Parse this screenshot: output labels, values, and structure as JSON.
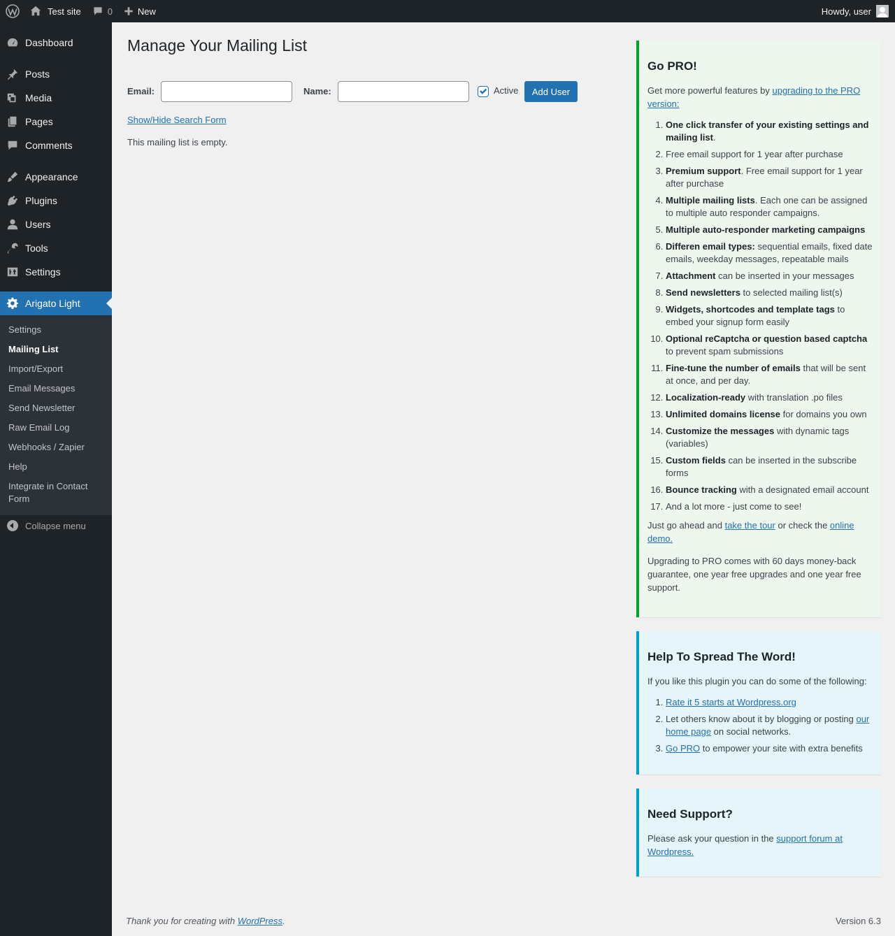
{
  "adminbar": {
    "site_name": "Test site",
    "comments_count": "0",
    "new_label": "New",
    "howdy": "Howdy, user"
  },
  "menu": {
    "items": [
      {
        "label": "Dashboard",
        "icon": "dashboard-icon"
      },
      {
        "label": "Posts",
        "icon": "pin-icon"
      },
      {
        "label": "Media",
        "icon": "media-icon"
      },
      {
        "label": "Pages",
        "icon": "pages-icon"
      },
      {
        "label": "Comments",
        "icon": "comment-icon"
      },
      {
        "label": "Appearance",
        "icon": "brush-icon"
      },
      {
        "label": "Plugins",
        "icon": "plug-icon"
      },
      {
        "label": "Users",
        "icon": "user-icon"
      },
      {
        "label": "Tools",
        "icon": "wrench-icon"
      },
      {
        "label": "Settings",
        "icon": "settings-icon"
      },
      {
        "label": "Arigato Light",
        "icon": "gear-icon"
      }
    ],
    "submenu": [
      "Settings",
      "Mailing List",
      "Import/Export",
      "Email Messages",
      "Send Newsletter",
      "Raw Email Log",
      "Webhooks / Zapier",
      "Help",
      "Integrate in Contact Form"
    ],
    "collapse_label": "Collapse menu"
  },
  "main": {
    "title": "Manage Your Mailing List",
    "email_label": "Email:",
    "name_label": "Name:",
    "active_label": "Active",
    "add_button": "Add User",
    "toggle_search": "Show/Hide Search Form",
    "empty_message": "This mailing list is empty."
  },
  "pro_box": {
    "title": "Go PRO!",
    "intro_text": "Get more powerful features by ",
    "intro_link": "upgrading to the PRO version:",
    "features": [
      {
        "bold": "One click transfer of your existing settings and mailing list",
        "rest": "."
      },
      {
        "bold": "",
        "rest": "Free email support for 1 year after purchase"
      },
      {
        "bold": "Premium support",
        "rest": ". Free email support for 1 year after purchase"
      },
      {
        "bold": "Multiple mailing lists",
        "rest": ". Each one can be assigned to multiple auto responder campaigns."
      },
      {
        "bold": "Multiple auto-responder marketing campaigns",
        "rest": ""
      },
      {
        "bold": "Differen email types:",
        "rest": " sequential emails, fixed date emails, weekday messages, repeatable mails"
      },
      {
        "bold": "Attachment",
        "rest": " can be inserted in your messages"
      },
      {
        "bold": "Send newsletters",
        "rest": " to selected mailing list(s)"
      },
      {
        "bold": "Widgets, shortcodes and template tags",
        "rest": " to embed your signup form easily"
      },
      {
        "bold": "Optional reCaptcha or question based captcha",
        "rest": " to prevent spam submissions"
      },
      {
        "bold": "Fine-tune the number of emails",
        "rest": " that will be sent at once, and per day."
      },
      {
        "bold": "Localization-ready",
        "rest": " with translation .po files"
      },
      {
        "bold": "Unlimited domains license",
        "rest": " for domains you own"
      },
      {
        "bold": "Customize the messages",
        "rest": " with dynamic tags (variables)"
      },
      {
        "bold": "Custom fields",
        "rest": " can be inserted in the subscribe forms"
      },
      {
        "bold": "Bounce tracking",
        "rest": " with a designated email account"
      },
      {
        "bold": "",
        "rest": "And a lot more - just come to see!"
      }
    ],
    "tour_pre": "Just go ahead and ",
    "tour_link": "take the tour",
    "tour_mid": " or check the ",
    "demo_link": "online demo.",
    "guarantee": "Upgrading to PRO comes with 60 days money-back guarantee, one year free upgrades and one year free support."
  },
  "spread_box": {
    "title": "Help To Spread The Word!",
    "intro": "If you like this plugin you can do some of the following:",
    "item1_link": "Rate it 5 starts at Wordpress.org",
    "item2_pre": "Let others know about it by blogging or posting ",
    "item2_link": "our home page",
    "item2_post": " on social networks.",
    "item3_link": "Go PRO",
    "item3_post": " to empower your site with extra benefits"
  },
  "support_box": {
    "title": "Need Support?",
    "text_pre": "Please ask your question in the ",
    "link": "support forum at Wordpress."
  },
  "footer": {
    "thanks_pre": "Thank you for creating with ",
    "thanks_link": "WordPress",
    "thanks_post": ".",
    "version": "Version 6.3"
  },
  "colors": {
    "admin_dark": "#1d2327",
    "primary_blue": "#2271b1",
    "pro_green": "#00a32a",
    "info_blue": "#00a0d2"
  }
}
